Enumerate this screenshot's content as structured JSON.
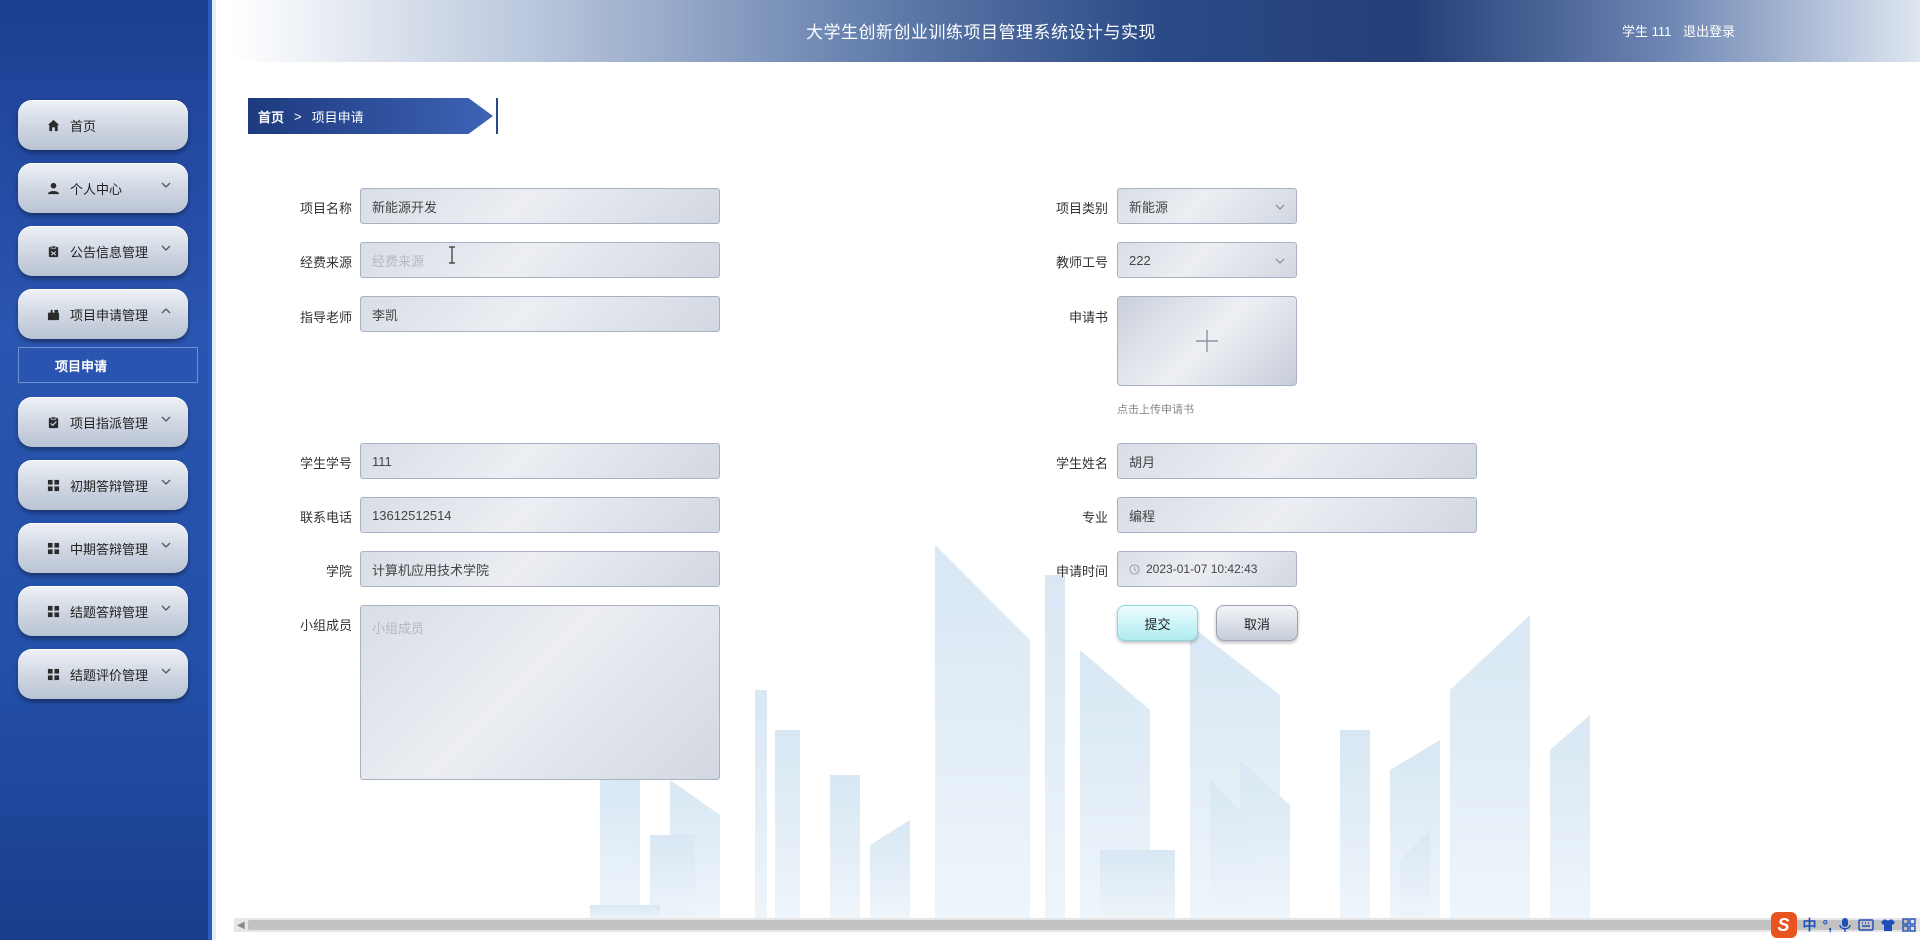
{
  "header": {
    "title": "大学生创新创业训练项目管理系统设计与实现",
    "user_label": "学生 111",
    "logout": "退出登录"
  },
  "sidebar": {
    "items": [
      {
        "label": "首页",
        "icon": "home-icon"
      },
      {
        "label": "个人中心",
        "icon": "person-icon"
      },
      {
        "label": "公告信息管理",
        "icon": "clipboard-icon"
      },
      {
        "label": "项目申请管理",
        "icon": "briefcase-icon"
      },
      {
        "label": "项目指派管理",
        "icon": "checklist-icon"
      },
      {
        "label": "初期答辩管理",
        "icon": "grid-icon"
      },
      {
        "label": "中期答辩管理",
        "icon": "grid-icon"
      },
      {
        "label": "结题答辩管理",
        "icon": "grid-icon"
      },
      {
        "label": "结题评价管理",
        "icon": "grid-icon"
      }
    ],
    "submenu_active": "项目申请"
  },
  "breadcrumb": {
    "home": "首页",
    "separator": ">",
    "current": "项目申请"
  },
  "form": {
    "project_name": {
      "label": "项目名称",
      "value": "新能源开发"
    },
    "funding_source": {
      "label": "经费来源",
      "placeholder": "经费来源"
    },
    "advisor": {
      "label": "指导老师",
      "value": "李凯"
    },
    "student_id": {
      "label": "学生学号",
      "value": "111"
    },
    "phone": {
      "label": "联系电话",
      "value": "13612512514"
    },
    "college": {
      "label": "学院",
      "value": "计算机应用技术学院"
    },
    "team_members": {
      "label": "小组成员",
      "placeholder": "小组成员"
    },
    "project_category": {
      "label": "项目类别",
      "value": "新能源"
    },
    "teacher_id": {
      "label": "教师工号",
      "value": "222"
    },
    "application": {
      "label": "申请书",
      "hint": "点击上传申请书"
    },
    "student_name": {
      "label": "学生姓名",
      "value": "胡月"
    },
    "major": {
      "label": "专业",
      "value": "编程"
    },
    "apply_time": {
      "label": "申请时间",
      "value": "2023-01-07 10:42:43"
    },
    "submit": "提交",
    "cancel": "取消"
  },
  "ime": {
    "lang": "中",
    "punct": "°,"
  },
  "colors": {
    "sidebar": "#2350a8",
    "header_dark": "#253f78",
    "submit_button": "#c7f3f7"
  }
}
